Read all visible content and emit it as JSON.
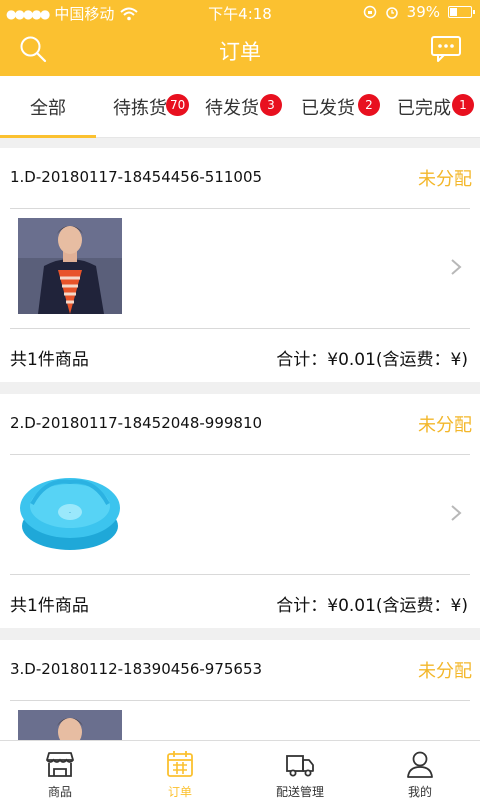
{
  "status_bar": {
    "signal": "●●●●●",
    "carrier": "中国移动",
    "time": "下午4:18",
    "battery": "39%",
    "battery_level": 0.39
  },
  "header": {
    "title": "订单"
  },
  "tabs": [
    {
      "label": "全部",
      "badge": ""
    },
    {
      "label": "待拣货",
      "badge": "70"
    },
    {
      "label": "待发货",
      "badge": "3"
    },
    {
      "label": "已发货",
      "badge": "2"
    },
    {
      "label": "已完成",
      "badge": "1"
    }
  ],
  "orders": [
    {
      "order_no": "1.D-20180117-18454456-511005",
      "status": "未分配",
      "product_count": "共1件商品",
      "total": "合计：¥0.01(含运费：¥)",
      "thumb": "jacket-model"
    },
    {
      "order_no": "2.D-20180117-18452048-999810",
      "status": "未分配",
      "product_count": "共1件商品",
      "total": "合计：¥0.01(含运费：¥)",
      "thumb": "blue-basin"
    },
    {
      "order_no": "3.D-20180112-18390456-975653",
      "status": "未分配",
      "product_count": "",
      "total": "",
      "thumb": "jacket-model"
    }
  ],
  "tab_bar": [
    {
      "label": "商品",
      "icon": "shop-icon"
    },
    {
      "label": "订单",
      "icon": "calendar-icon"
    },
    {
      "label": "配送管理",
      "icon": "truck-icon"
    },
    {
      "label": "我的",
      "icon": "person-icon"
    }
  ],
  "colors": {
    "accent": "#fbc130",
    "badge": "#e8101f",
    "status": "#f3b72b"
  }
}
